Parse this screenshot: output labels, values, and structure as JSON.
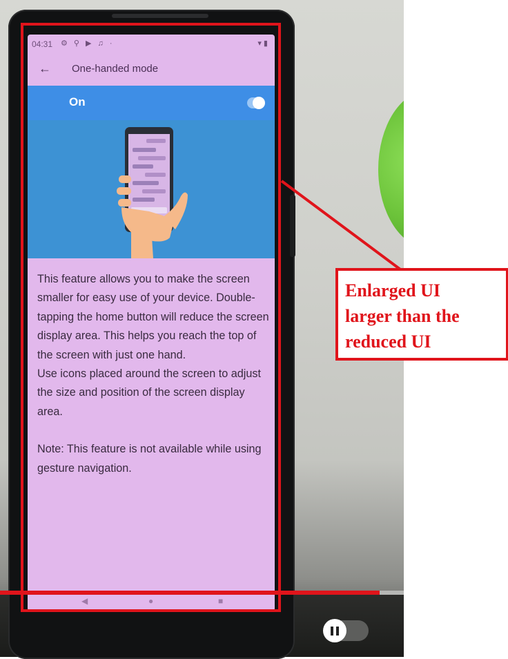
{
  "statusbar": {
    "time": "04:31",
    "icons_left": "⚙ ⚲ ▶ ♫ ·",
    "icons_right": "▾ ▮"
  },
  "appbar": {
    "title": "One-handed mode"
  },
  "toggle_row": {
    "label": "On",
    "state": "on"
  },
  "description": {
    "para1": "This feature allows you to make the screen smaller for easy use of your device. Double-tapping the home button will reduce the screen display area. This helps you reach the top of the screen with just one hand.",
    "para2": "Use icons placed around the screen to adjust the size and position of the screen display area.",
    "note": "Note: This feature is not available while using gesture navigation."
  },
  "annotation": {
    "line1": "Enlarged UI",
    "line2": "larger than the",
    "line3": "reduced UI"
  },
  "video": {
    "progress": 0.94
  },
  "colors": {
    "accent_blue": "#3e8ee6",
    "screen_tint": "#e2b8ec",
    "annotation_red": "#e0141b"
  }
}
